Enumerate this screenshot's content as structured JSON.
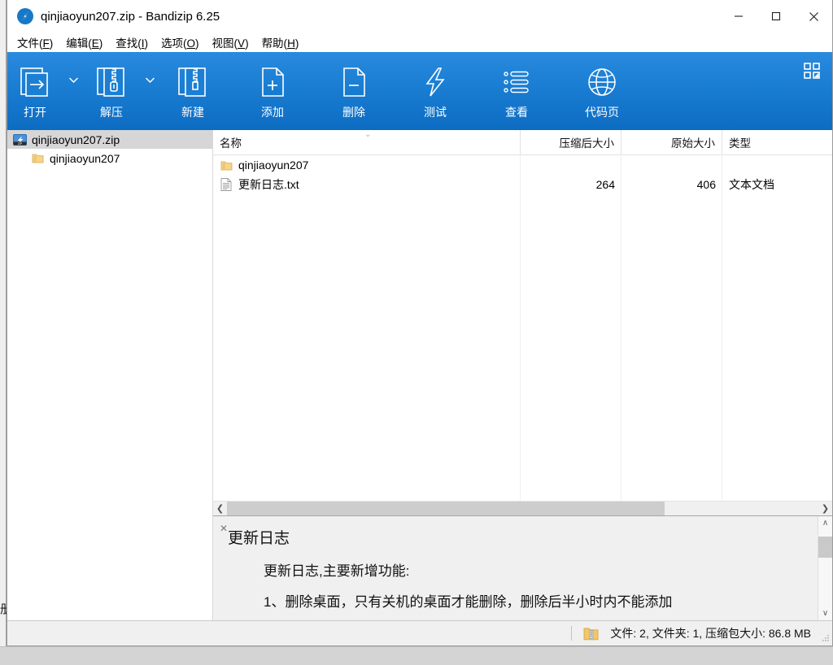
{
  "window": {
    "title": "qinjiaoyun207.zip - Bandizip 6.25",
    "app_icon": "bandizip-logo-icon",
    "minimize_label": "—",
    "maximize_label": "☐",
    "close_label": "✕"
  },
  "menu": [
    {
      "text": "文件(F)",
      "label": "文件",
      "accel": "F",
      "name": "menu-file"
    },
    {
      "text": "编辑(E)",
      "label": "编辑",
      "accel": "E",
      "name": "menu-edit"
    },
    {
      "text": "查找(I)",
      "label": "查找",
      "accel": "I",
      "name": "menu-find"
    },
    {
      "text": "选项(O)",
      "label": "选项",
      "accel": "O",
      "name": "menu-options"
    },
    {
      "text": "视图(V)",
      "label": "视图",
      "accel": "V",
      "name": "menu-view"
    },
    {
      "text": "帮助(H)",
      "label": "帮助",
      "accel": "H",
      "name": "menu-help"
    }
  ],
  "toolbar": {
    "background_color": "#1b7fd4",
    "buttons": [
      {
        "label": "打开",
        "icon": "open-archive-icon",
        "has_caret": true
      },
      {
        "label": "解压",
        "icon": "extract-icon",
        "has_caret": true
      },
      {
        "label": "新建",
        "icon": "new-archive-icon",
        "has_caret": false
      },
      {
        "label": "添加",
        "icon": "add-file-icon",
        "has_caret": false
      },
      {
        "label": "删除",
        "icon": "delete-file-icon",
        "has_caret": false
      },
      {
        "label": "测试",
        "icon": "test-archive-icon",
        "has_caret": false
      },
      {
        "label": "查看",
        "icon": "view-list-icon",
        "has_caret": false
      },
      {
        "label": "代码页",
        "icon": "globe-codepage-icon",
        "has_caret": false
      }
    ],
    "layout_toggle_icon": "panel-layout-icon"
  },
  "tree": {
    "items": [
      {
        "label": "qinjiaoyun207.zip",
        "icon": "zip-archive-icon",
        "selected": true,
        "level": 0
      },
      {
        "label": "qinjiaoyun207",
        "icon": "folder-icon",
        "selected": false,
        "level": 1
      }
    ]
  },
  "file_list": {
    "columns": [
      {
        "key": "name",
        "label": "名称",
        "align": "left"
      },
      {
        "key": "packed",
        "label": "压缩后大小",
        "align": "right"
      },
      {
        "key": "size",
        "label": "原始大小",
        "align": "right"
      },
      {
        "key": "type",
        "label": "类型",
        "align": "left"
      }
    ],
    "sort_indicator": "⌄",
    "rows": [
      {
        "name": "qinjiaoyun207",
        "icon": "folder-icon",
        "packed": "",
        "size": "",
        "type": ""
      },
      {
        "name": "更新日志.txt",
        "icon": "text-document-icon",
        "packed": "264",
        "size": "406",
        "type": "文本文档"
      }
    ]
  },
  "hscrollbar": {
    "left_arrow": "❮",
    "right_arrow": "❯",
    "thumb_percent": 74
  },
  "preview": {
    "close_label": "✕",
    "title": "更新日志",
    "lines": [
      "更新日志,主要新增功能:",
      "1、删除桌面，只有关机的桌面才能删除，删除后半小时内不能添加"
    ],
    "scroll_up": "∧",
    "scroll_down": "∨"
  },
  "status_bar": {
    "icon": "archive-icon",
    "text": "文件: 2, 文件夹: 1, 压缩包大小: 86.8 MB",
    "files_count": 2,
    "folders_count": 1,
    "archive_size": "86.8 MB"
  },
  "background": {
    "artifact_text": "册"
  }
}
